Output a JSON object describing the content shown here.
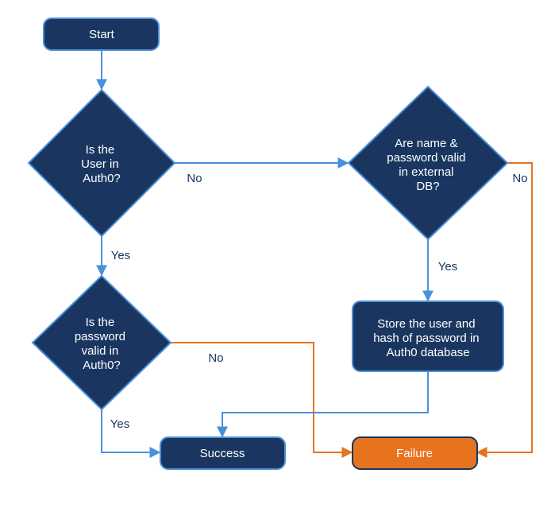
{
  "nodes": {
    "start": {
      "label": "Start"
    },
    "d1": {
      "line1": "Is the",
      "line2": "User in",
      "line3": "Auth0?"
    },
    "d2": {
      "line1": "Are name &",
      "line2": "password valid",
      "line3": "in external",
      "line4": "DB?"
    },
    "d3": {
      "line1": "Is the",
      "line2": "password",
      "line3": "valid in",
      "line4": "Auth0?"
    },
    "store": {
      "line1": "Store the user and",
      "line2": "hash of password in",
      "line3": "Auth0 database"
    },
    "success": {
      "label": "Success"
    },
    "failure": {
      "label": "Failure"
    }
  },
  "edges": {
    "d1_yes": "Yes",
    "d1_no": "No",
    "d2_yes": "Yes",
    "d2_no": "No",
    "d3_yes": "Yes",
    "d3_no": "No"
  }
}
